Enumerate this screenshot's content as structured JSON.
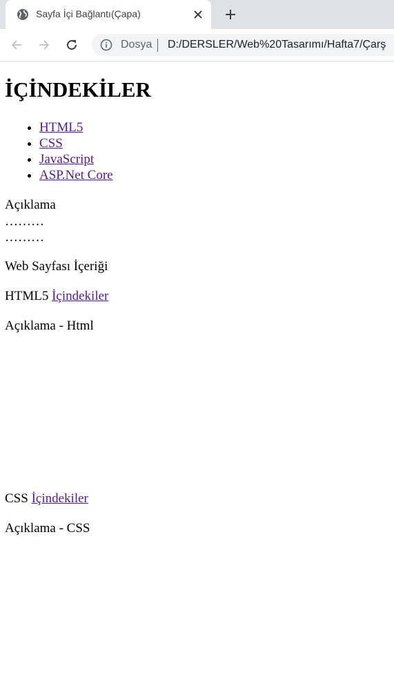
{
  "browser": {
    "tab_title": "Sayfa İçi Bağlantı(Çapa)",
    "address_label": "Dosya",
    "address_url": "D:/DERSLER/Web%20Tasarımı/Hafta7/Çarş"
  },
  "page": {
    "heading": "İÇİNDEKİLER",
    "toc": [
      "HTML5",
      "CSS",
      "JavaScript",
      "ASP.Net Core"
    ],
    "description_title": "Açıklama",
    "ellipsis_1": "………",
    "ellipsis_2": "………",
    "content_title": "Web Sayfası İçeriği",
    "sections": [
      {
        "name": "HTML5",
        "back_link": "İçindekiler",
        "description": "Açıklama - Html"
      },
      {
        "name": "CSS",
        "back_link": "İçindekiler",
        "description": "Açıklama - CSS"
      }
    ]
  },
  "colors": {
    "link": "#551a8b",
    "tabstrip": "#dee1e6",
    "omnibox": "#f1f3f4"
  },
  "icons": [
    "globe-icon",
    "close-icon",
    "plus-icon",
    "back-arrow-icon",
    "forward-arrow-icon",
    "reload-icon",
    "info-icon"
  ]
}
